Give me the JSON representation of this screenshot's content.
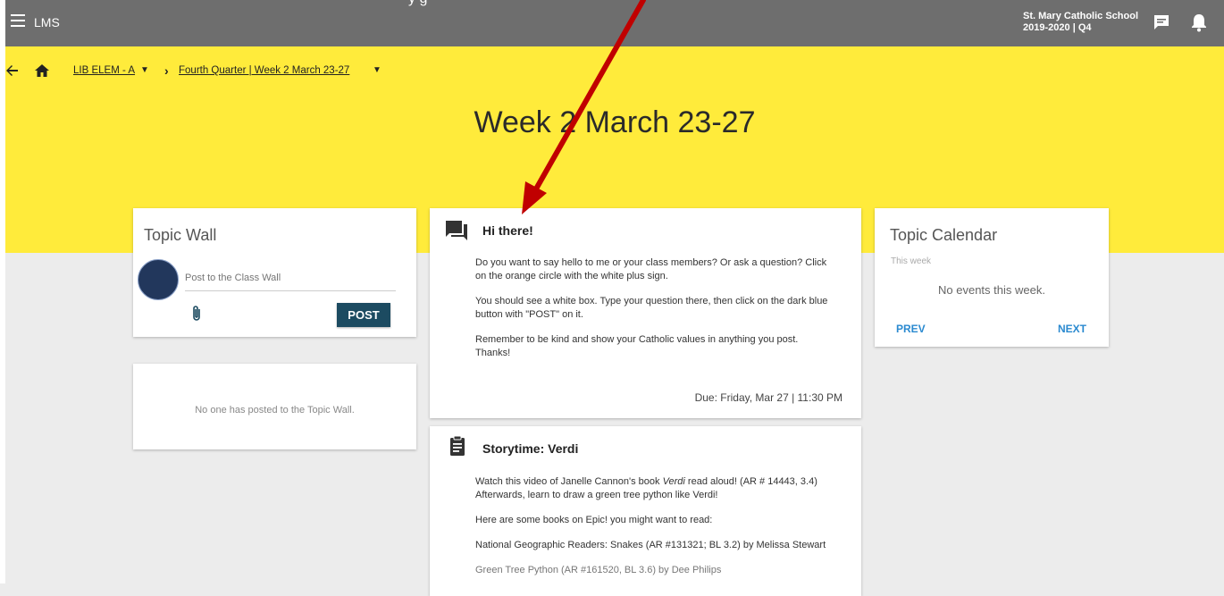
{
  "topbar": {
    "app_name": "LMS",
    "school_name": "St. Mary Catholic School",
    "term": "2019-2020 | Q4",
    "menu_icon": "hamburger-icon",
    "chat_icon": "chat-icon",
    "bell_icon": "bell-icon",
    "color": "#6e6e6e"
  },
  "banner": {
    "color": "#ffeb3b",
    "page_title": "Week 2 March 23-27"
  },
  "breadcrumb": {
    "course": "LIB ELEM - A",
    "topic": "Fourth Quarter  |  Week 2 March 23-27"
  },
  "topic_wall": {
    "title": "Topic Wall",
    "placeholder": "Post to the Class Wall",
    "post_label": "POST",
    "empty_text": "No one has posted to the Topic Wall."
  },
  "posts": [
    {
      "icon": "forum-icon",
      "title": "Hi there!",
      "paragraphs": [
        "Do you want to say hello to me or your class members?  Or ask a question?  Click on the orange circle with the white plus sign.",
        "You should see a white box.  Type your question there, then click on the dark blue button with \"POST\" on it.",
        "Remember to be kind and show your Catholic values in anything you post. Thanks!"
      ],
      "due": "Due: Friday, Mar 27 | 11:30 PM"
    },
    {
      "icon": "assignment-icon",
      "title": "Storytime: Verdi",
      "line1_pre": "Watch this video of Janelle Cannon's book ",
      "line1_italic": "Verdi",
      "line1_post": " read aloud!  (AR # 14443, 3.4) Afterwards, learn to draw a green tree python like Verdi!",
      "paragraphs": [
        "Here are some books on Epic! you might want to read:",
        "National Geographic Readers:  Snakes (AR #131321; BL 3.2) by Melissa Stewart",
        "Green Tree Python (AR #161520, BL 3.6) by Dee Philips"
      ]
    }
  ],
  "calendar": {
    "title": "Topic Calendar",
    "subtitle": "This week",
    "empty_text": "No events this week.",
    "prev_label": "PREV",
    "next_label": "NEXT"
  },
  "overlay": {
    "partial_text": "y           g",
    "arrow_color": "#c00000"
  }
}
